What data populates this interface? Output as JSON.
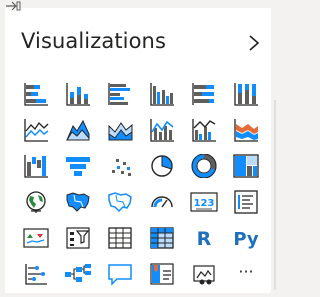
{
  "header": {
    "title": "Visualizations"
  },
  "colors": {
    "accent": "#118DFF",
    "dark": "#252423",
    "mid": "#605e5c",
    "orange": "#E66C37"
  },
  "icons": [
    [
      "stacked-bar-chart",
      "stacked-column-chart",
      "clustered-bar-chart",
      "clustered-column-chart",
      "100-stacked-bar-chart",
      "100-stacked-column-chart"
    ],
    [
      "line-chart",
      "area-chart",
      "stacked-area-chart",
      "line-and-stacked-column-chart",
      "line-and-clustered-column-chart",
      "ribbon-chart"
    ],
    [
      "waterfall-chart",
      "funnel-chart",
      "scatter-chart",
      "pie-chart",
      "donut-chart",
      "treemap"
    ],
    [
      "map",
      "filled-map",
      "shape-map",
      "gauge",
      "card",
      "multi-row-card"
    ],
    [
      "kpi",
      "slicer",
      "table",
      "matrix",
      "r-script-visual",
      "python-visual"
    ],
    [
      "key-influencers",
      "decomposition-tree",
      "qa",
      "smart-narrative",
      "paginated-report",
      "more-visuals"
    ]
  ],
  "labels": {
    "card": "123",
    "r_visual": "R",
    "python_visual": "Py",
    "more": "···"
  }
}
